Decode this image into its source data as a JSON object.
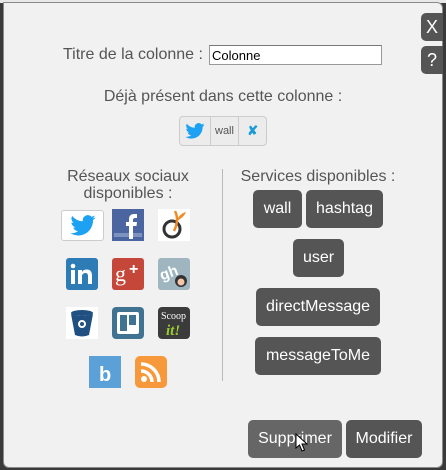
{
  "dialog": {
    "close_label": "X",
    "help_label": "?",
    "title_label": "Titre de la colonne :",
    "title_value": "Colonne",
    "present_label": "Déjà présent dans cette colonne :",
    "present_items": [
      {
        "network": "twitter-icon",
        "service": "wall",
        "remove": "✘"
      }
    ],
    "social_header_line1": "Réseaux sociaux",
    "social_header_line2": "disponibles :",
    "social_networks": [
      "twitter",
      "facebook",
      "viadeo",
      "linkedin",
      "google-plus",
      "github",
      "bitbucket",
      "trello",
      "scoop-it",
      "bitly",
      "rss"
    ],
    "scoopit_text1": "Scoop",
    "scoopit_text2": "it!",
    "services_header": "Services disponibles :",
    "services": [
      "wall",
      "hashtag",
      "user",
      "directMessage",
      "messageToMe"
    ],
    "delete_label": "Supprimer",
    "modify_label": "Modifier"
  },
  "colors": {
    "button": "#555555",
    "twitter": "#1da1f2",
    "panel": "#f1f1f1"
  }
}
